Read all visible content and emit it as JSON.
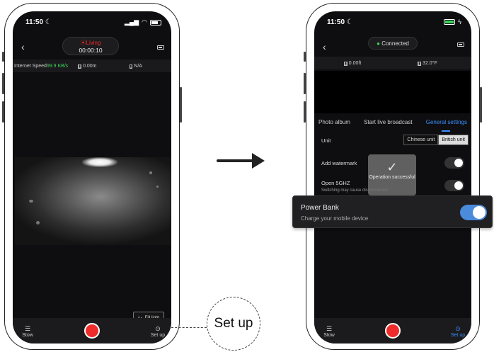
{
  "left_phone": {
    "time": "11:50",
    "recording": {
      "status": "Living",
      "timer": "00:00:10"
    },
    "info": {
      "speed_label": "Internet Speed",
      "speed_value": "99.9 KB/s",
      "distance": "0.00m",
      "na": "N/A"
    },
    "fill_light": "Fill light",
    "tabs": {
      "stow": "Stow",
      "setup": "Set up"
    }
  },
  "right_phone": {
    "time": "11:50",
    "connection": "Connected",
    "info": {
      "distance": "0.00ft",
      "temperature": "32.0°F"
    },
    "settings_tabs": [
      "Photo album",
      "Start live broadcast",
      "General settings"
    ],
    "unit_label": "Unit",
    "unit_options": [
      "Chinese unit",
      "British unit"
    ],
    "watermark_label": "Add watermark",
    "wifi_label": "Open 5GHZ",
    "wifi_sub": "Switching may cause disconnection",
    "toast": "Operation successful",
    "tabs": {
      "stow": "Stow",
      "setup": "Set up"
    }
  },
  "power_bank": {
    "title": "Power Bank",
    "subtitle": "Charge your mobile device",
    "enabled": true
  },
  "callout": "Set up",
  "colors": {
    "record": "#ef2b2b",
    "accent": "#3a8fff",
    "speed": "#3cd25a",
    "toggle_on": "#4a8bdc"
  }
}
